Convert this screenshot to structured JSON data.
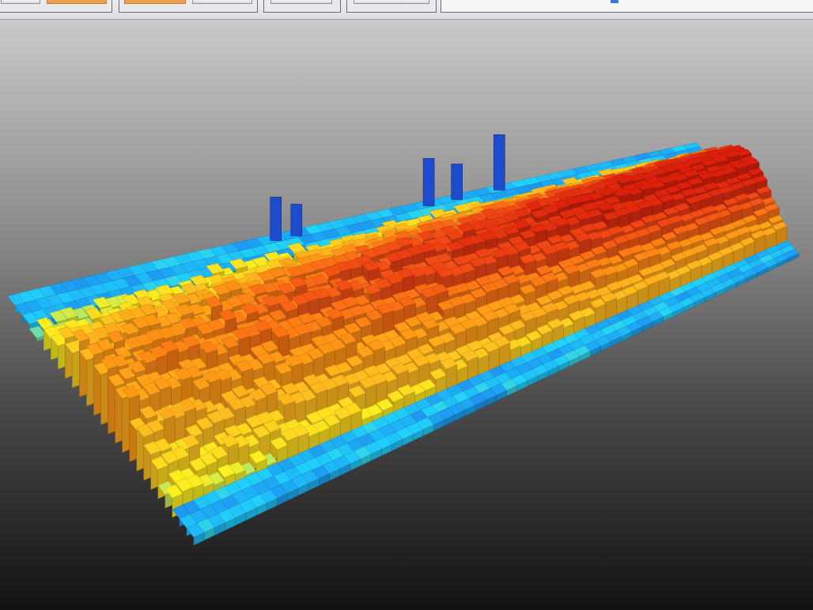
{
  "window": {
    "title": ""
  },
  "toolbar": {
    "groups": [
      {
        "id": "group-1",
        "buttons": [
          "view-mode",
          "color-mode"
        ],
        "active": "color-mode"
      },
      {
        "id": "group-2",
        "buttons": [
          "layer-orange",
          "layer-normal"
        ],
        "active": "layer-orange"
      },
      {
        "id": "group-3",
        "buttons": [
          "tool-a"
        ],
        "active": ""
      },
      {
        "id": "group-4",
        "buttons": [
          "tool-b"
        ],
        "active": ""
      }
    ],
    "field_value": ""
  },
  "scene": {
    "description_icon": "3d-voxel-terrain",
    "background": {
      "top": "#c9c9c9",
      "bottom": "#121212"
    },
    "colormap": [
      "#1e46c8",
      "#1c6be0",
      "#1ec8f0",
      "#f0e61e",
      "#f5b41e",
      "#f58a14",
      "#e64614",
      "#d21e0a"
    ]
  }
}
